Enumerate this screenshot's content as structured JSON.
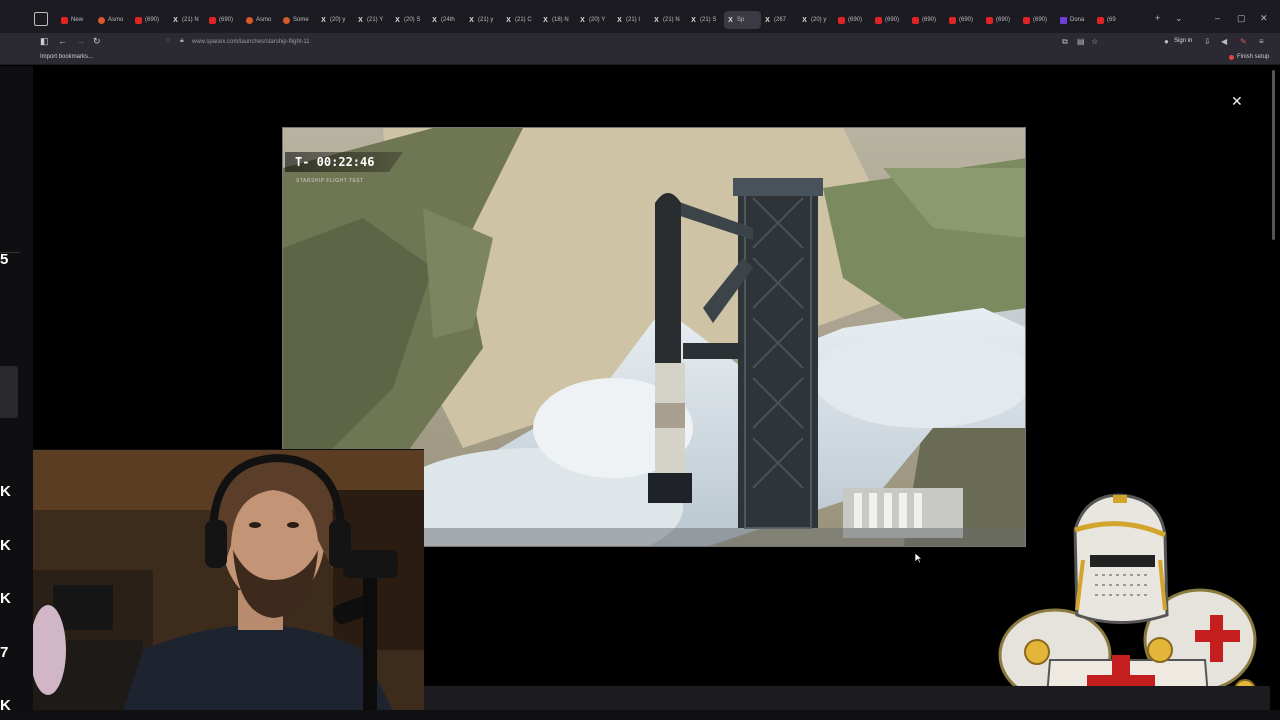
{
  "browser": {
    "tabs": [
      {
        "label": "New",
        "icon": "yt"
      },
      {
        "label": "Asmo",
        "icon": "asmon"
      },
      {
        "label": "(690)",
        "icon": "yt"
      },
      {
        "label": "(21) N",
        "icon": "x"
      },
      {
        "label": "(690)",
        "icon": "yt"
      },
      {
        "label": "Asmo",
        "icon": "asmon"
      },
      {
        "label": "Some",
        "icon": "asmon"
      },
      {
        "label": "(20) y",
        "icon": "x"
      },
      {
        "label": "(21) Y",
        "icon": "x"
      },
      {
        "label": "(20) S",
        "icon": "x"
      },
      {
        "label": "(24th",
        "icon": "x"
      },
      {
        "label": "(21) y",
        "icon": "x"
      },
      {
        "label": "(21) C",
        "icon": "x"
      },
      {
        "label": "(18) N",
        "icon": "x"
      },
      {
        "label": "(20) Y",
        "icon": "x"
      },
      {
        "label": "(21) I",
        "icon": "x"
      },
      {
        "label": "(21) N",
        "icon": "x"
      },
      {
        "label": "(21) S",
        "icon": "x"
      },
      {
        "label": "Sp",
        "icon": "x",
        "active": true
      },
      {
        "label": "(267",
        "icon": "x"
      },
      {
        "label": "(20) y",
        "icon": "x"
      },
      {
        "label": "(690)",
        "icon": "yt"
      },
      {
        "label": "(690)",
        "icon": "yt"
      },
      {
        "label": "(690)",
        "icon": "yt"
      },
      {
        "label": "(690)",
        "icon": "yt"
      },
      {
        "label": "(690)",
        "icon": "yt"
      },
      {
        "label": "(690)",
        "icon": "yt"
      },
      {
        "label": "Dona",
        "icon": "twitch"
      },
      {
        "label": "(69",
        "icon": "yt"
      }
    ],
    "url": "www.spacex.com/launches/starship-flight-11",
    "sign_in_label": "Sign in",
    "bookmark_import_label": "Import bookmarks...",
    "finish_setup_label": "Finish setup"
  },
  "left_strip": {
    "numbers": [
      "5",
      "K",
      "K",
      "K",
      "7",
      "K"
    ]
  },
  "video": {
    "countdown": "T- 00:22:46",
    "subtitle": "STARSHIP FLIGHT TEST"
  },
  "colors": {
    "browser_chrome": "#1c1b22",
    "toolbar": "#2b2a33",
    "page_bg": "#000000",
    "knight_red": "#c41e1e"
  }
}
